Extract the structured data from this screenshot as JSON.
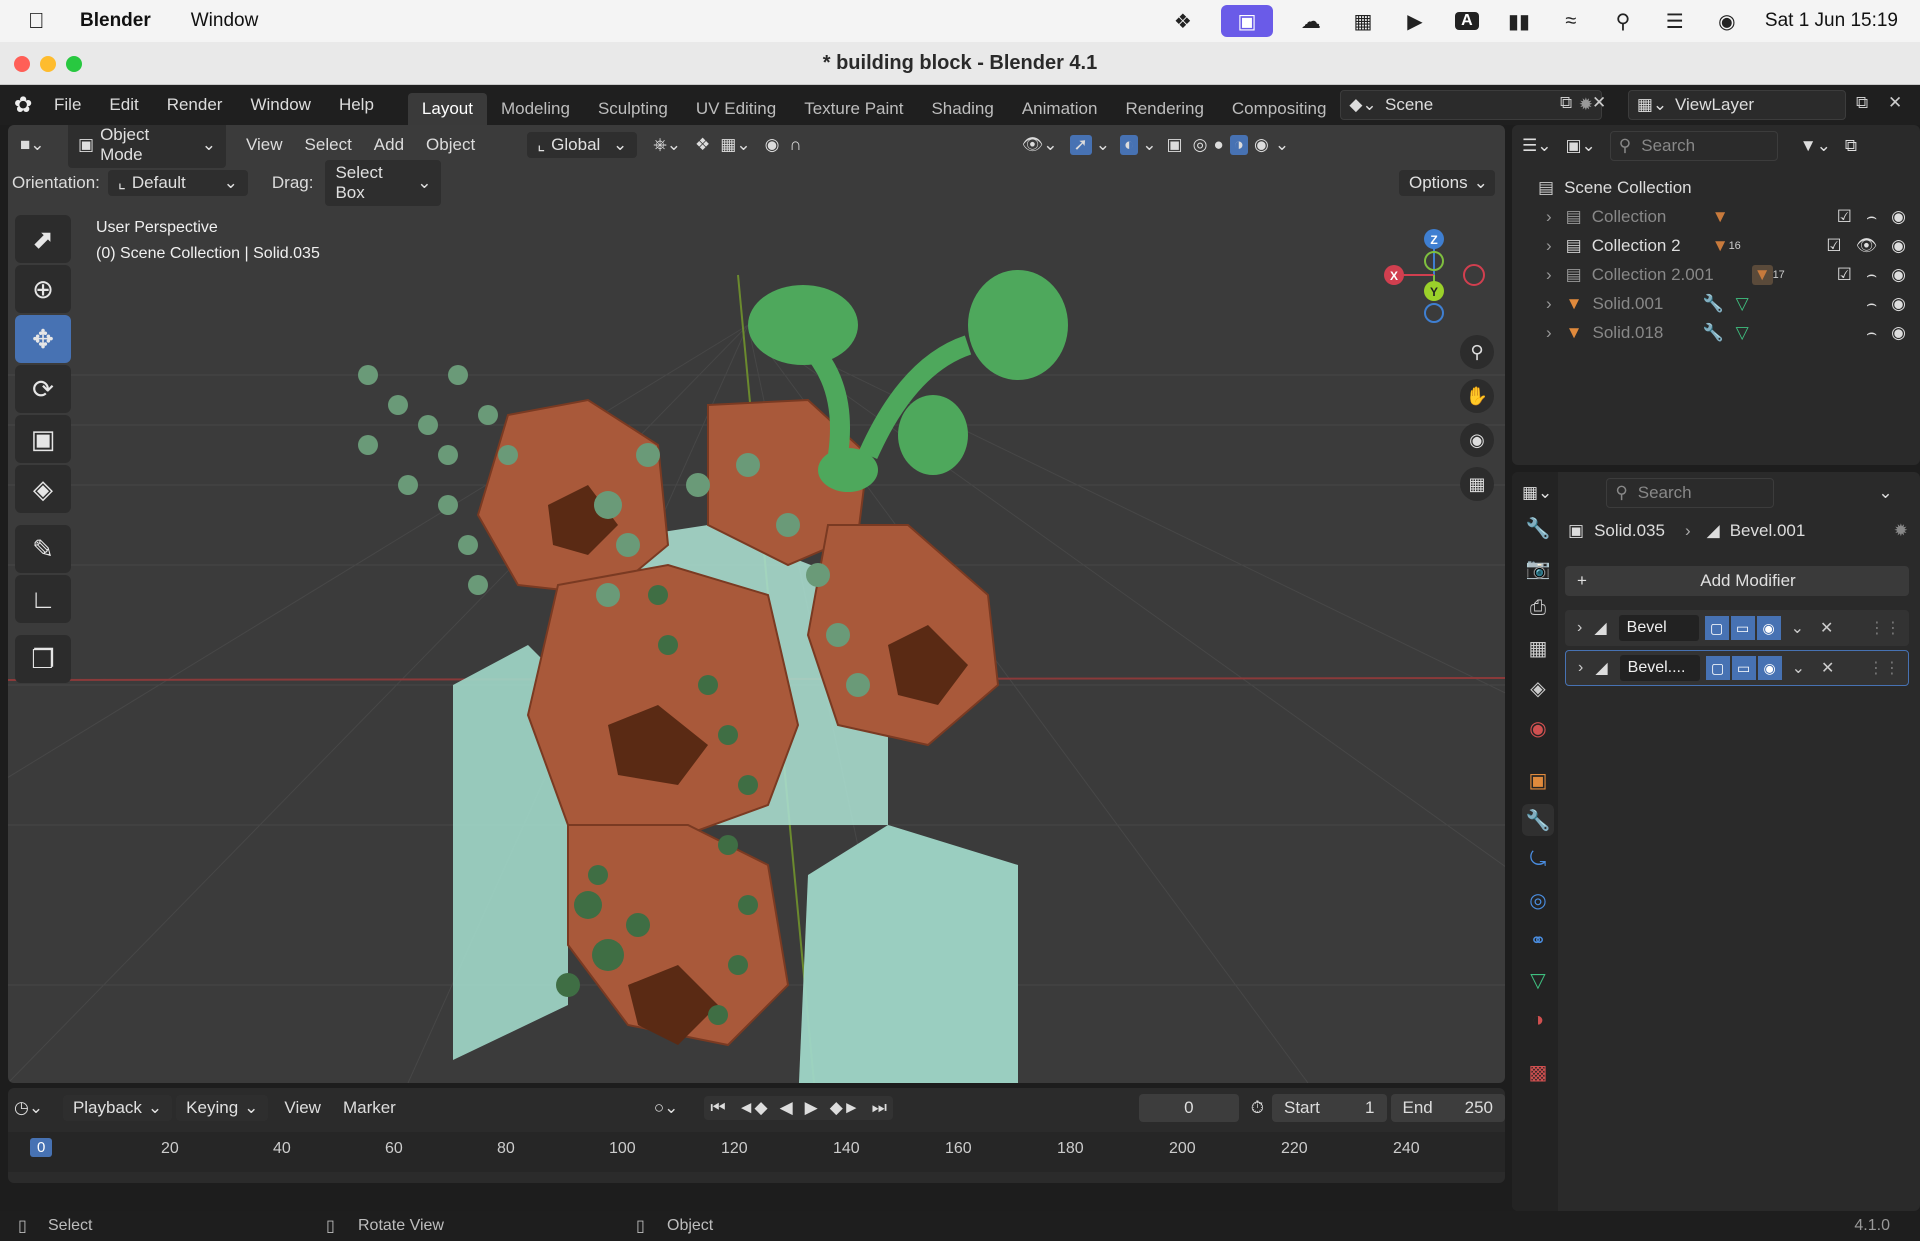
{
  "macbar": {
    "app": "Blender",
    "window_menu": "Window",
    "datetime": "Sat 1 Jun  15:19",
    "input_badge": "A"
  },
  "window": {
    "title": "* building block - Blender 4.1"
  },
  "menubar": {
    "items": [
      "File",
      "Edit",
      "Render",
      "Window",
      "Help"
    ]
  },
  "workspaces": [
    "Layout",
    "Modeling",
    "Sculpting",
    "UV Editing",
    "Texture Paint",
    "Shading",
    "Animation",
    "Rendering",
    "Compositing"
  ],
  "scene": {
    "label": "Scene",
    "view_layer": "ViewLayer"
  },
  "viewport": {
    "mode": "Object Mode",
    "menus": [
      "View",
      "Select",
      "Add",
      "Object"
    ],
    "transform": "Global",
    "orientation_label": "Orientation:",
    "orientation_value": "Default",
    "drag_label": "Drag:",
    "drag_value": "Select Box",
    "options": "Options",
    "overlay_line1": "User Perspective",
    "overlay_line2": "(0) Scene Collection | Solid.035",
    "gizmo": {
      "z": "Z",
      "x": "X",
      "y": "Y"
    }
  },
  "outliner": {
    "search_placeholder": "Search",
    "root": "Scene Collection",
    "items": [
      {
        "name": "Collection",
        "badge": ""
      },
      {
        "name": "Collection 2",
        "badge": "16"
      },
      {
        "name": "Collection 2.001",
        "badge": "17"
      },
      {
        "name": "Solid.001",
        "badge": ""
      },
      {
        "name": "Solid.018",
        "badge": ""
      }
    ]
  },
  "properties": {
    "search_placeholder": "Search",
    "object": "Solid.035",
    "modifier_path": "Bevel.001",
    "add_modifier": "Add Modifier",
    "modifiers": [
      "Bevel",
      "Bevel...."
    ]
  },
  "timeline": {
    "menus": [
      "Playback",
      "Keying",
      "View",
      "Marker"
    ],
    "current_frame": "0",
    "start_label": "Start",
    "start": "1",
    "end_label": "End",
    "end": "250",
    "current_marker": "0",
    "ruler": [
      "20",
      "40",
      "60",
      "80",
      "100",
      "120",
      "140",
      "160",
      "180",
      "200",
      "220",
      "240"
    ]
  },
  "statusbar": {
    "select": "Select",
    "rotate": "Rotate View",
    "object": "Object",
    "version": "4.1.0"
  },
  "colors": {
    "accent": "#4772b3",
    "terracotta": "#a9593a",
    "mint": "#9fd6c7",
    "leaf": "#4ea85c",
    "moss": "#6a9a78"
  }
}
